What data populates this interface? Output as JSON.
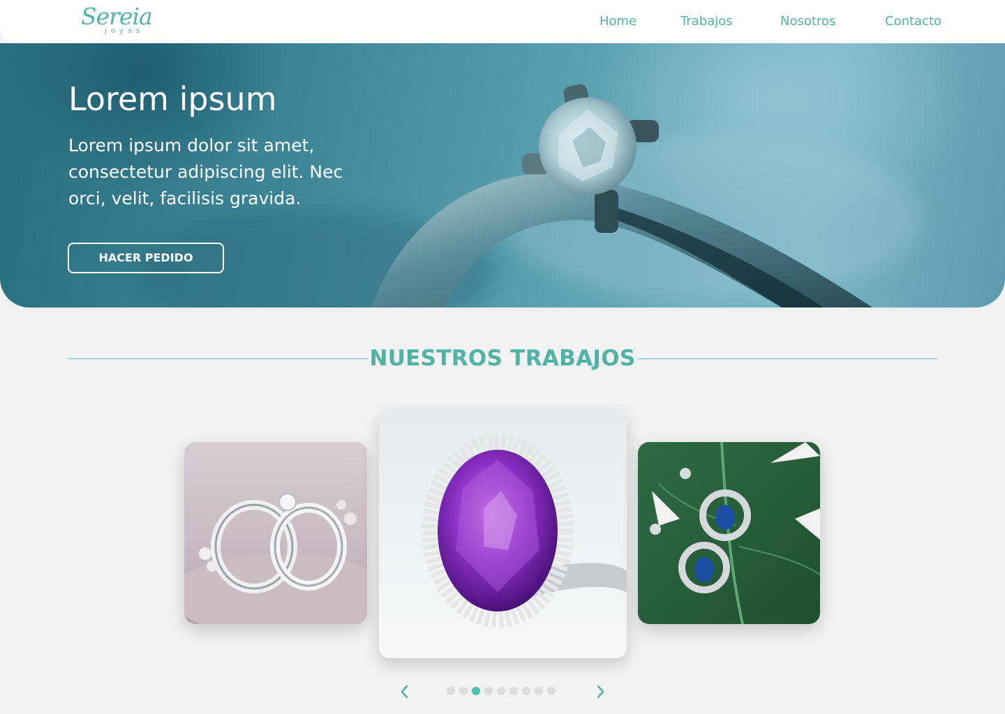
{
  "header": {
    "logo": {
      "main": "Sereia",
      "sub": "joyas"
    },
    "nav": [
      "Home",
      "Trabajos",
      "Nosotros",
      "Contacto"
    ]
  },
  "hero": {
    "title": "Lorem ipsum",
    "text": "Lorem ipsum dolor sit amet, consectetur adipiscing elit. Nec orci, velit, facilisis gravida.",
    "button_label": "HACER PEDIDO"
  },
  "works": {
    "title": "NUESTROS TRABAJOS",
    "cards": [
      {
        "name": "wedding-rings-photo"
      },
      {
        "name": "amethyst-ring-photo"
      },
      {
        "name": "sapphire-earrings-photo"
      }
    ],
    "pager": {
      "total": 9,
      "active_index": 2
    }
  },
  "colors": {
    "accent": "#4fb3a6",
    "dot_active": "#4fc0b3",
    "dot_inactive": "#dcdcdc",
    "background": "#f2f2f2"
  },
  "icons": {
    "prev": "chevron-left-icon",
    "next": "chevron-right-icon"
  }
}
